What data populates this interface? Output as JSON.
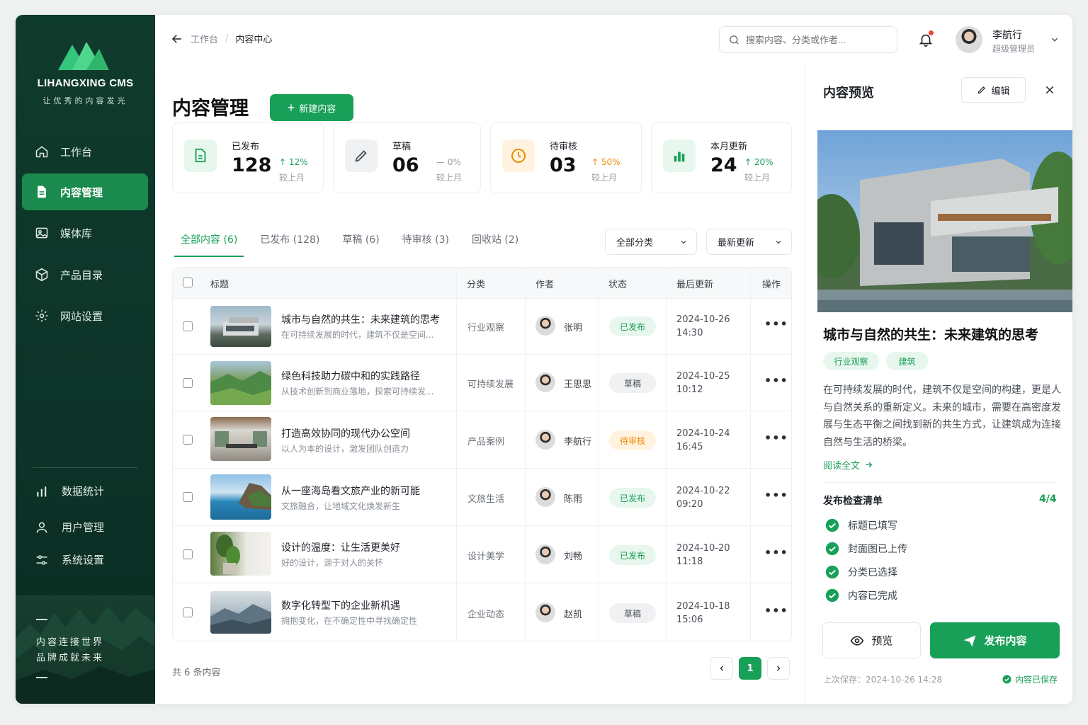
{
  "sidebar": {
    "brand": "LIHANGXING CMS",
    "slogan": "让优秀的内容发光",
    "nav": [
      {
        "label": "工作台",
        "icon": "home-icon"
      },
      {
        "label": "内容管理",
        "icon": "document-icon",
        "active": true
      },
      {
        "label": "媒体库",
        "icon": "image-icon"
      },
      {
        "label": "产品目录",
        "icon": "box-icon"
      },
      {
        "label": "网站设置",
        "icon": "gear-icon"
      }
    ],
    "nav_secondary": [
      {
        "label": "数据统计",
        "icon": "bar-chart-icon"
      },
      {
        "label": "用户管理",
        "icon": "user-icon"
      },
      {
        "label": "系统设置",
        "icon": "sliders-icon"
      }
    ],
    "quote_line1": "内容连接世界",
    "quote_line2": "品牌成就未来"
  },
  "topbar": {
    "breadcrumb": [
      "工作台",
      "内容中心"
    ],
    "search_placeholder": "搜索内容、分类或作者...",
    "user_name": "李航行",
    "user_role": "超级管理员"
  },
  "main": {
    "title": "内容管理",
    "new_button": "新建内容",
    "stats": [
      {
        "label": "已发布",
        "value": "128",
        "change": "↑ 12%",
        "sub": "较上月",
        "color": "#18a058"
      },
      {
        "label": "草稿",
        "value": "06",
        "change": "— 0%",
        "sub": "较上月",
        "color": "#9aa0a6"
      },
      {
        "label": "待审核",
        "value": "03",
        "change": "↑ 50%",
        "sub": "较上月",
        "color": "#f08c00"
      },
      {
        "label": "本月更新",
        "value": "24",
        "change": "↑ 20%",
        "sub": "较上月",
        "color": "#18a058"
      }
    ],
    "tabs": [
      "全部内容 (6)",
      "已发布 (128)",
      "草稿 (6)",
      "待审核 (3)",
      "回收站 (2)"
    ],
    "filter_category": "全部分类",
    "filter_sort": "最新更新",
    "columns": [
      "标题",
      "分类",
      "作者",
      "状态",
      "最后更新",
      "操作"
    ],
    "rows": [
      {
        "title": "城市与自然的共生：未来建筑的思考",
        "summary": "在可持续发展的时代，建筑不仅是空间...",
        "category": "行业观察",
        "author": "张明",
        "status": "已发布",
        "date": "2024-10-26",
        "time": "14:30"
      },
      {
        "title": "绿色科技助力碳中和的实践路径",
        "summary": "从技术创新到商业落地，探索可持续发...",
        "category": "可持续发展",
        "author": "王思思",
        "status": "草稿",
        "date": "2024-10-25",
        "time": "10:12"
      },
      {
        "title": "打造高效协同的现代办公空间",
        "summary": "以人为本的设计，激发团队创造力",
        "category": "产品案例",
        "author": "李航行",
        "status": "待审核",
        "date": "2024-10-24",
        "time": "16:45"
      },
      {
        "title": "从一座海岛看文旅产业的新可能",
        "summary": "文旅融合，让地域文化焕发新生",
        "category": "文旅生活",
        "author": "陈雨",
        "status": "已发布",
        "date": "2024-10-22",
        "time": "09:20"
      },
      {
        "title": "设计的温度：让生活更美好",
        "summary": "好的设计，源于对人的关怀",
        "category": "设计美学",
        "author": "刘畅",
        "status": "已发布",
        "date": "2024-10-20",
        "time": "11:18"
      },
      {
        "title": "数字化转型下的企业新机遇",
        "summary": "拥抱变化，在不确定性中寻找确定性",
        "category": "企业动态",
        "author": "赵凯",
        "status": "草稿",
        "date": "2024-10-18",
        "time": "15:06"
      }
    ],
    "total": "共 6 条内容",
    "current_page": "1"
  },
  "preview": {
    "title": "内容预览",
    "edit_button": "编辑",
    "article_title": "城市与自然的共生：未来建筑的思考",
    "tags": [
      "行业观察",
      "建筑"
    ],
    "body": "在可持续发展的时代，建筑不仅是空间的构建，更是人与自然关系的重新定义。未来的城市，需要在高密度发展与生态平衡之间找到新的共生方式，让建筑成为连接自然与生活的桥梁。",
    "read_more": "阅读全文",
    "checklist_title": "发布检查清单",
    "checklist_count": "4/4",
    "checklist": [
      "标题已填写",
      "封面图已上传",
      "分类已选择",
      "内容已完成"
    ],
    "preview_button": "预览",
    "publish_button": "发布内容",
    "last_saved": "上次保存：2024-10-26 14:28",
    "saved_status": "内容已保存"
  },
  "colors": {
    "accent": "#18a058",
    "sidebar": "#0f3b2c",
    "warning": "#f08c00"
  }
}
